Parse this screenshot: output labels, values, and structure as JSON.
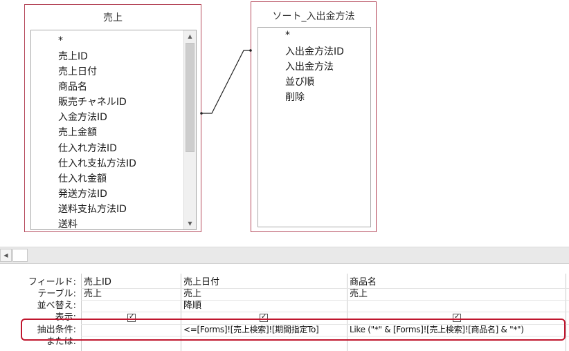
{
  "tables": [
    {
      "title": "売上",
      "fields": [
        "*",
        "売上ID",
        "売上日付",
        "商品名",
        "販売チャネルID",
        "入金方法ID",
        "売上金額",
        "仕入れ方法ID",
        "仕入れ支払方法ID",
        "仕入れ金額",
        "発送方法ID",
        "送料支払方法ID",
        "送料"
      ]
    },
    {
      "title": "ソート_入出金方法",
      "fields": [
        "*",
        "入出金方法ID",
        "入出金方法",
        "並び順",
        "削除"
      ]
    }
  ],
  "grid": {
    "row_labels": [
      "フィールド:",
      "テーブル:",
      "並べ替え:",
      "表示:",
      "抽出条件:",
      "または:"
    ],
    "columns": [
      {
        "field": "売上ID",
        "table": "売上",
        "sort": "",
        "show": true,
        "criteria": ""
      },
      {
        "field": "売上日付",
        "table": "売上",
        "sort": "降順",
        "show": true,
        "criteria": "<=[Forms]![売上検索]![期間指定To]"
      },
      {
        "field": "商品名",
        "table": "売上",
        "sort": "",
        "show": true,
        "criteria": "Like (\"*\" & [Forms]![売上検索]![商品名] & \"*\")"
      }
    ]
  },
  "icons": {
    "scroll_up": "scroll-up-arrow-icon",
    "scroll_down": "scroll-down-arrow-icon",
    "scroll_left": "scroll-left-arrow-icon",
    "checkmark": "checkmark-icon"
  },
  "colors": {
    "table_border": "#b5485a",
    "highlight": "#c0162e"
  }
}
